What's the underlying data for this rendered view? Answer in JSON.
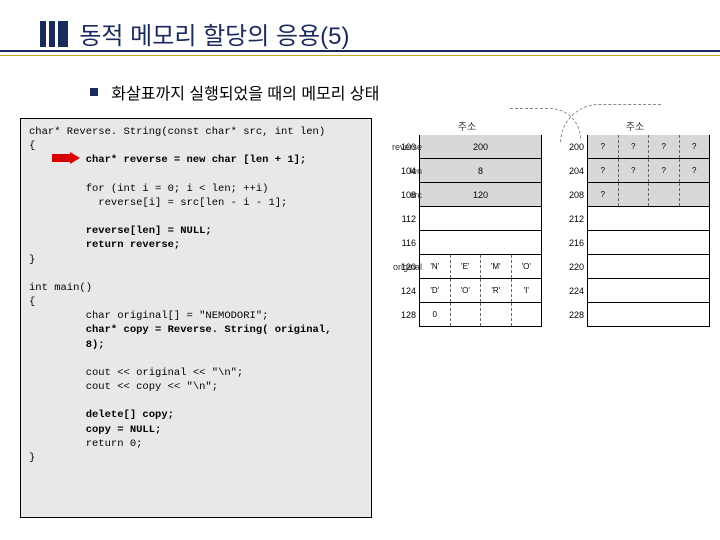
{
  "title": "동적 메모리 할당의 응용(5)",
  "bullet": "화살표까지 실행되었을 때의 메모리 상태",
  "code": {
    "l1": "char* Reverse. String(const char* src, int len)",
    "l2": "{",
    "l3": "         char* reverse = new char [len + 1];",
    "l4": "",
    "l5": "         for (int i = 0; i < len; ++i)",
    "l6": "           reverse[i] = src[len - i - 1];",
    "l7": "",
    "l8": "         reverse[len] = NULL;",
    "l9": "         return reverse;",
    "l10": "}",
    "l11": "",
    "l12": "int main()",
    "l13": "{",
    "l14": "         char original[] = \"NEMODORI\";",
    "l15": "         char* copy = Reverse. String( original,",
    "l16": "         8);",
    "l17": "",
    "l18": "         cout << original << \"\\n\";",
    "l19": "         cout << copy << \"\\n\";",
    "l20": "",
    "l21": "         delete[] copy;",
    "l22": "         copy = NULL;",
    "l23": "         return 0;",
    "l24": "}"
  },
  "mem_left": {
    "header": "주소",
    "rows": [
      {
        "addr": "100",
        "lab": "reverse",
        "val": "200",
        "shade": true
      },
      {
        "addr": "104",
        "lab": "len",
        "val": "8",
        "shade": true
      },
      {
        "addr": "108",
        "lab": "src",
        "val": "120",
        "shade": true
      },
      {
        "addr": "112",
        "lab": "",
        "val": "",
        "shade": false
      },
      {
        "addr": "116",
        "lab": "",
        "val": "",
        "shade": false
      }
    ],
    "origLabel": "original",
    "origAddr": "120",
    "origCells": [
      "'N'",
      "'E'",
      "'M'",
      "'O'"
    ],
    "row124": {
      "addr": "124",
      "cells": [
        "'D'",
        "'O'",
        "'R'",
        "'I'"
      ]
    },
    "row128": {
      "addr": "128",
      "cells": [
        "0",
        "",
        "",
        ""
      ]
    }
  },
  "mem_right": {
    "header": "주소",
    "rows": [
      {
        "addr": "200",
        "cells": [
          "?",
          "?",
          "?",
          "?"
        ],
        "shade": true
      },
      {
        "addr": "204",
        "cells": [
          "?",
          "?",
          "?",
          "?"
        ],
        "shade": true
      },
      {
        "addr": "208",
        "cells": [
          "?",
          "",
          "",
          ""
        ],
        "shade": true
      },
      {
        "addr": "212",
        "val": ""
      },
      {
        "addr": "216",
        "val": ""
      },
      {
        "addr": "220",
        "val": ""
      },
      {
        "addr": "224",
        "val": ""
      },
      {
        "addr": "228",
        "val": ""
      }
    ]
  }
}
